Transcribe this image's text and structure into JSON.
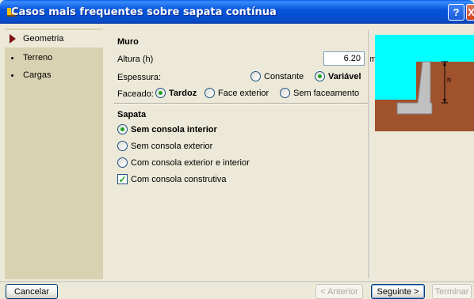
{
  "window": {
    "title": "Casos mais frequentes sobre sapata contínua",
    "help_label": "?",
    "close_label": "X"
  },
  "sidebar": {
    "items": [
      {
        "label": "Geometria",
        "active": true
      },
      {
        "label": "Terreno",
        "active": false
      },
      {
        "label": "Cargas",
        "active": false
      }
    ]
  },
  "muro": {
    "title": "Muro",
    "altura_label": "Altura (h)",
    "altura_value": "6.20",
    "altura_unit": "m",
    "espessura_label": "Espessura:",
    "espessura_options": [
      {
        "label": "Constante",
        "selected": false
      },
      {
        "label": "Variável",
        "selected": true
      }
    ],
    "faceado_label": "Faceado:",
    "faceado_options": [
      {
        "label": "Tardoz",
        "selected": true
      },
      {
        "label": "Face exterior",
        "selected": false
      },
      {
        "label": "Sem faceamento",
        "selected": false
      }
    ]
  },
  "sapata": {
    "title": "Sapata",
    "options": [
      {
        "label": "Sem consola interior",
        "selected": true
      },
      {
        "label": "Sem consola exterior",
        "selected": false
      },
      {
        "label": "Com consola exterior e interior",
        "selected": false
      }
    ],
    "checkbox_label": "Com consola construtiva",
    "checkbox_checked": true
  },
  "diagram": {
    "h_label": "h",
    "colors": {
      "sky": "#00FFFF",
      "soil": "#A0522D",
      "concrete": "#C0C0C0"
    }
  },
  "footer": {
    "cancel_label": "Cancelar",
    "prev_label": "< Anterior",
    "next_label": "Seguinte >",
    "finish_label": "Terminar"
  }
}
